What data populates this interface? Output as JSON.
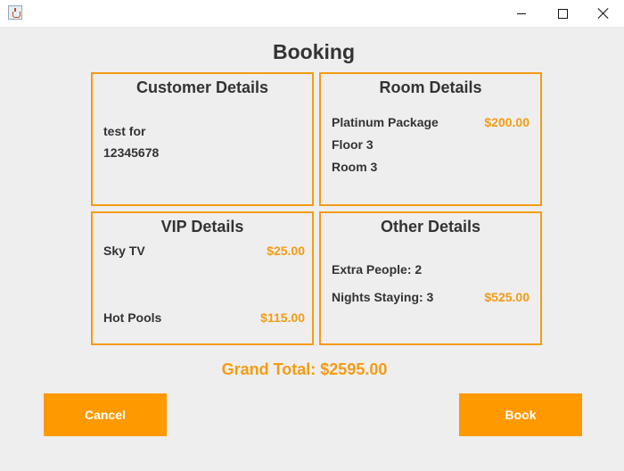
{
  "window": {
    "minimize_label": "",
    "maximize_label": "",
    "close_label": ""
  },
  "page": {
    "title": "Booking"
  },
  "customer": {
    "title": "Customer Details",
    "name": "test for",
    "phone": "12345678"
  },
  "room": {
    "title": "Room Details",
    "package": "Platinum Package",
    "package_price": "$200.00",
    "floor": "Floor 3",
    "room": "Room 3"
  },
  "vip": {
    "title": "VIP Details",
    "items": [
      {
        "label": "Sky TV",
        "price": "$25.00"
      },
      {
        "label": "Hot Pools",
        "price": "$115.00"
      }
    ]
  },
  "other": {
    "title": "Other Details",
    "extra_people": "Extra People: 2",
    "nights": "Nights Staying: 3",
    "nights_price": "$525.00"
  },
  "grand_total": "Grand Total: $2595.00",
  "buttons": {
    "cancel": "Cancel",
    "book": "Book"
  },
  "colors": {
    "accent": "#f39c12",
    "button": "#ff9900",
    "background": "#eeeeee"
  },
  "icons": {
    "app": "java-coffee-icon",
    "minimize": "minimize-icon",
    "maximize": "maximize-icon",
    "close": "close-icon"
  }
}
